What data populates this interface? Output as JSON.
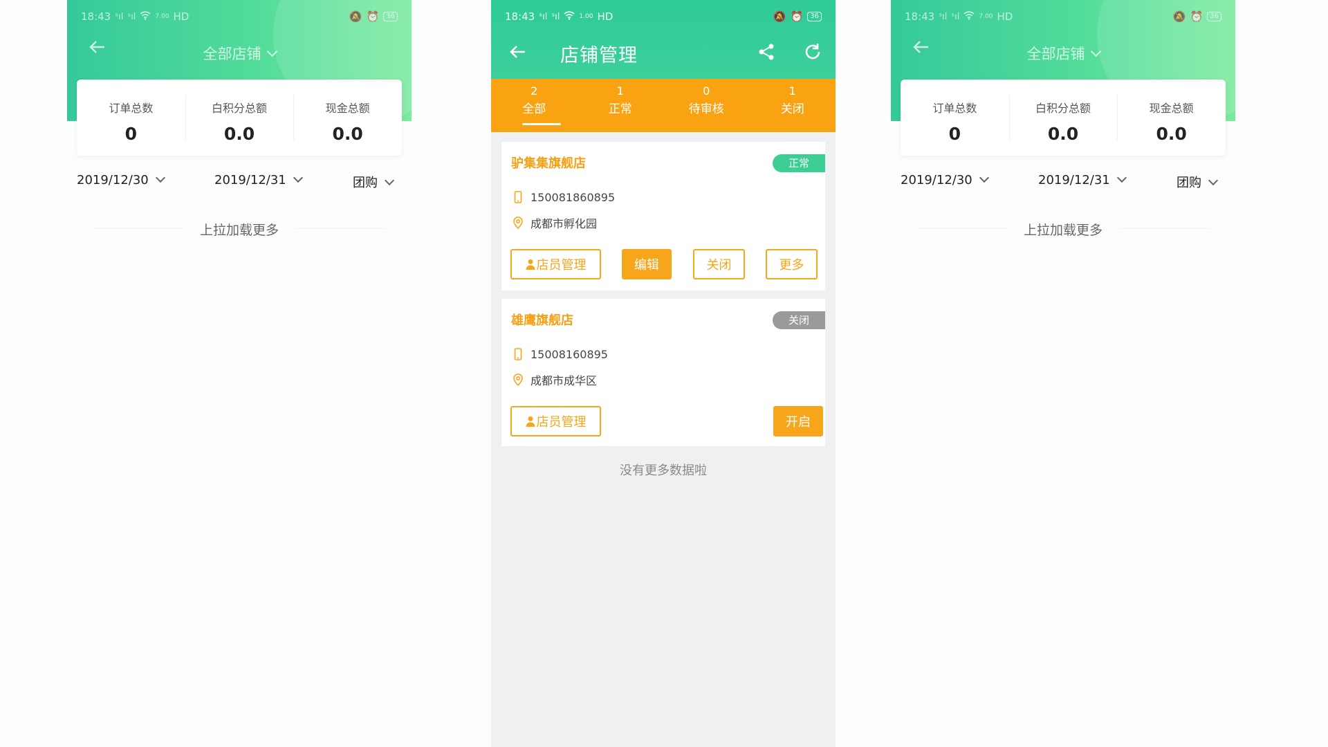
{
  "status_bar": {
    "time": "18:43",
    "signal1": "ˢıl",
    "signal2": "ˢıl",
    "net_speed": "7.00",
    "net_type": "HD",
    "battery": "36"
  },
  "side_screen": {
    "title": "全部店铺",
    "summary": [
      {
        "label": "订单总数",
        "value": "0"
      },
      {
        "label": "白积分总额",
        "value": "0.0"
      },
      {
        "label": "现金总额",
        "value": "0.0"
      }
    ],
    "filters": {
      "start_date": "2019/12/30",
      "end_date": "2019/12/31",
      "type": "团购"
    },
    "load_more": "上拉加载更多"
  },
  "center": {
    "status_net_speed": "1.00",
    "title": "店铺管理",
    "tabs": [
      {
        "count": "2",
        "label": "全部"
      },
      {
        "count": "1",
        "label": "正常"
      },
      {
        "count": "0",
        "label": "待审核"
      },
      {
        "count": "1",
        "label": "关闭"
      }
    ],
    "stores": [
      {
        "name": "驴集集旗舰店",
        "status": "正常",
        "phone": "150081860895",
        "address": "成都市孵化园",
        "buttons": {
          "staff": "店员管理",
          "edit": "编辑",
          "close": "关闭",
          "more": "更多"
        }
      },
      {
        "name": "雄鹰旗舰店",
        "status": "关闭",
        "phone": "15008160895",
        "address": "成都市成华区",
        "buttons": {
          "staff": "店员管理",
          "open": "开启"
        }
      }
    ],
    "no_more": "没有更多数据啦"
  },
  "colors": {
    "green": "#35c99a",
    "orange": "#f7a51b",
    "gray_badge": "#9a9a9a"
  }
}
